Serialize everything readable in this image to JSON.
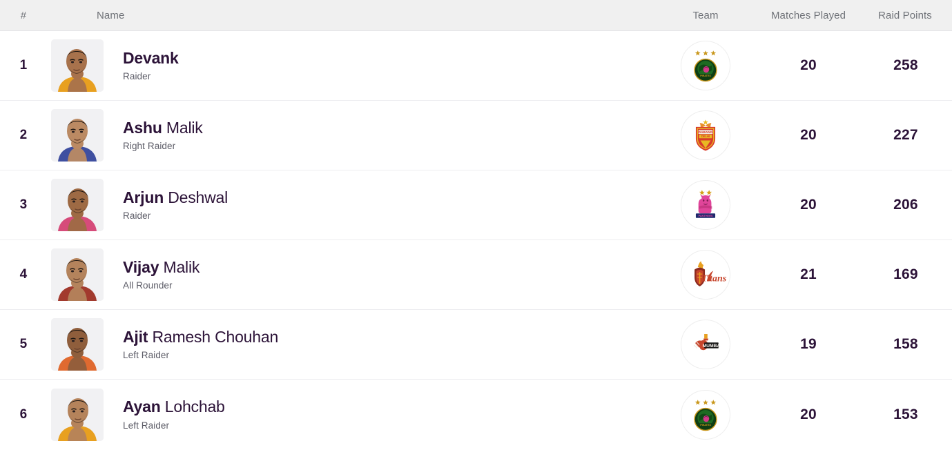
{
  "header": {
    "rank_label": "#",
    "name_label": "Name",
    "team_label": "Team",
    "matches_label": "Matches Played",
    "raid_points_label": "Raid Points"
  },
  "colors": {
    "header_bg": "#f0f0f0",
    "header_text": "#6f7278",
    "value_text": "#2c1338",
    "row_divider": "#ededf0",
    "row_bg": "#ffffff"
  },
  "rows": [
    {
      "rank": "1",
      "first_name": "Devank",
      "last_name": "",
      "role": "Raider",
      "team": "patna-pirates",
      "matches_played": "20",
      "raid_points": "258",
      "jersey_color": "#e8a020",
      "skin": "#a8724c"
    },
    {
      "rank": "2",
      "first_name": "Ashu",
      "last_name": "Malik",
      "role": "Right Raider",
      "team": "dabang-delhi",
      "matches_played": "20",
      "raid_points": "227",
      "jersey_color": "#3f4fa0",
      "skin": "#bb8a63"
    },
    {
      "rank": "3",
      "first_name": "Arjun",
      "last_name": "Deshwal",
      "role": "Raider",
      "team": "jaipur-pink-panthers",
      "matches_played": "20",
      "raid_points": "206",
      "jersey_color": "#d64b7a",
      "skin": "#9e6a44"
    },
    {
      "rank": "4",
      "first_name": "Vijay",
      "last_name": "Malik",
      "role": "All Rounder",
      "team": "telugu-titans",
      "matches_played": "21",
      "raid_points": "169",
      "jersey_color": "#a23a2e",
      "skin": "#b4835c"
    },
    {
      "rank": "5",
      "first_name": "Ajit",
      "last_name": "Ramesh Chouhan",
      "role": "Left Raider",
      "team": "u-mumba",
      "matches_played": "19",
      "raid_points": "158",
      "jersey_color": "#e06a30",
      "skin": "#8f5e3c"
    },
    {
      "rank": "6",
      "first_name": "Ayan",
      "last_name": "Lohchab",
      "role": "Left Raider",
      "team": "patna-pirates",
      "matches_played": "20",
      "raid_points": "153",
      "jersey_color": "#e8a020",
      "skin": "#b5835b"
    }
  ]
}
